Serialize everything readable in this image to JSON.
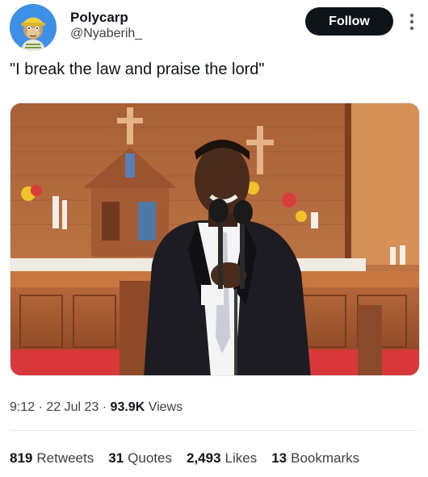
{
  "author": {
    "display_name": "Polycarp",
    "handle": "@Nyaberih_",
    "avatar_icon": "bored-ape-avatar-icon"
  },
  "follow_label": "Follow",
  "more_icon": "vertical-ellipsis-icon",
  "tweet": {
    "text": "\"I break the law and praise the lord\"",
    "image_icon": "photo-man-speaking-at-church-altar"
  },
  "meta": {
    "time": "9:12",
    "date": "22 Jul 23",
    "views_count": "93.9K",
    "views_label": "Views"
  },
  "stats": {
    "retweets": {
      "count": "819",
      "label": "Retweets"
    },
    "quotes": {
      "count": "31",
      "label": "Quotes"
    },
    "likes": {
      "count": "2,493",
      "label": "Likes"
    },
    "bookmarks": {
      "count": "13",
      "label": "Bookmarks"
    }
  },
  "colors": {
    "primary_text": "#0f1419",
    "secondary_text": "#3c3f44",
    "follow_button_bg": "#0f1419",
    "avatar_bg": "#3e8fe6"
  }
}
